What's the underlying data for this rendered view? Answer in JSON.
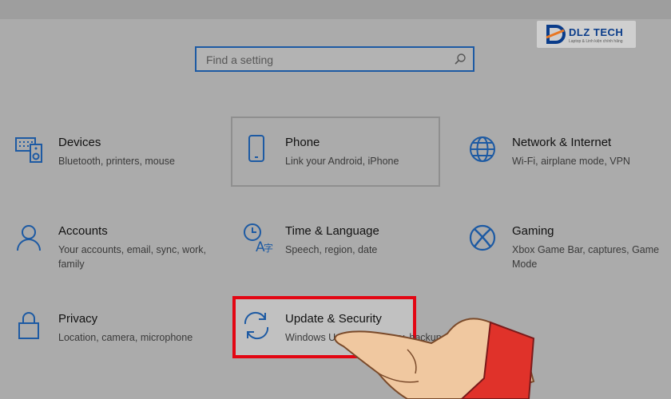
{
  "watermark": {
    "brand": "DLZ TECH",
    "tagline": "Laptop & Linh kiện chính hãng"
  },
  "search": {
    "placeholder": "Find a setting"
  },
  "tiles": [
    {
      "title": "Devices",
      "desc": "Bluetooth, printers, mouse"
    },
    {
      "title": "Phone",
      "desc": "Link your Android, iPhone"
    },
    {
      "title": "Network & Internet",
      "desc": "Wi-Fi, airplane mode, VPN"
    },
    {
      "title": "Accounts",
      "desc": "Your accounts, email, sync, work, family"
    },
    {
      "title": "Time & Language",
      "desc": "Speech, region, date"
    },
    {
      "title": "Gaming",
      "desc": "Xbox Game Bar, captures, Game Mode"
    },
    {
      "title": "Privacy",
      "desc": "Location, camera, microphone"
    },
    {
      "title": "Update & Security",
      "desc": "Windows Update, recovery, backup"
    }
  ],
  "colors": {
    "accent": "#1d5aa3",
    "highlight": "#e30613",
    "background": "#ababab"
  }
}
